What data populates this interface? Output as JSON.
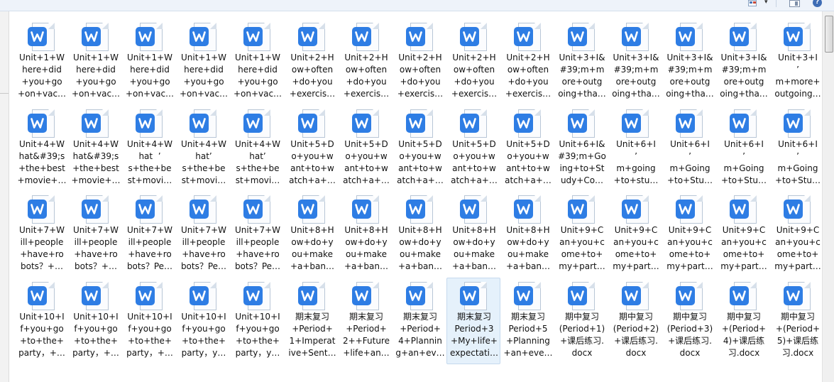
{
  "toolbar": {
    "icons": [
      "view-options-icon",
      "dropdown-arrow-icon",
      "preview-pane-icon",
      "help-icon"
    ],
    "arrow_glyph": "▾",
    "help_glyph": "?"
  },
  "colors": {
    "wps_blue": "#2e7de4",
    "selection_bg": "#e5f1fb",
    "selection_border": "#c5d9ee"
  },
  "files": [
    [
      "Unit+1+W\nhere+did\n+you+go\n+on+vac…",
      "Unit+1+W\nhere+did\n+you+go\n+on+vac…",
      "Unit+1+W\nhere+did\n+you+go\n+on+vac…",
      "Unit+1+W\nhere+did\n+you+go\n+on+vac…",
      "Unit+1+W\nhere+did\n+you+go\n+on+vac…",
      "Unit+2+H\now+often\n+do+you\n+exercis…",
      "Unit+2+H\now+often\n+do+you\n+exercis…",
      "Unit+2+H\now+often\n+do+you\n+exercis…",
      "Unit+2+H\now+often\n+do+you\n+exercis…",
      "Unit+2+H\now+often\n+do+you\n+exercis…",
      "Unit+3+I&\n#39;m+m\nore+outg\noing+tha…",
      "Unit+3+I&\n#39;m+m\nore+outg\noing+tha…",
      "Unit+3+I&\n#39;m+m\nore+outg\noing+tha…",
      "Unit+3+I&\n#39;m+m\nore+outg\noing+tha…",
      "Unit+3+I\n’\nm+more+\noutgoing…"
    ],
    [
      "Unit+4+W\nhat&#39;s\n+the+best\n+movie+…",
      "Unit+4+W\nhat&#39;s\n+the+best\n+movie+…",
      "Unit+4+W\nhat  ’\ns+the+be\nst+movi…",
      "Unit+4+W\nhat’\ns+the+be\nst+movi…",
      "Unit+4+W\nhat’\ns+the+be\nst+movi…",
      "Unit+5+D\no+you+w\nant+to+w\natch+a+…",
      "Unit+5+D\no+you+w\nant+to+w\natch+a+…",
      "Unit+5+D\no+you+w\nant+to+w\natch+a+…",
      "Unit+5+D\no+you+w\nant+to+w\natch+a+…",
      "Unit+5+D\no+you+w\nant+to+w\natch+a+…",
      "Unit+6+I&\n#39;m+Go\ning+to+St\nudy+Co…",
      "Unit+6+I\n’\nm+going\n+to+stu…",
      "Unit+6+I\n’\nm+Going\n+to+Stu…",
      "Unit+6+I\n’\nm+Going\n+to+Stu…",
      "Unit+6+I\n’\nm+Going\n+to+Stu…"
    ],
    [
      "Unit+7+W\nill+people\n+have+ro\nbots？+…",
      "Unit+7+W\nill+people\n+have+ro\nbots？+…",
      "Unit+7+W\nill+people\n+have+ro\nbots？Pe…",
      "Unit+7+W\nill+people\n+have+ro\nbots？Pe…",
      "Unit+7+W\nill+people\n+have+ro\nbots？Pe…",
      "Unit+8+H\now+do+y\nou+make\n+a+ban…",
      "Unit+8+H\now+do+y\nou+make\n+a+ban…",
      "Unit+8+H\now+do+y\nou+make\n+a+ban…",
      "Unit+8+H\now+do+y\nou+make\n+a+ban…",
      "Unit+8+H\now+do+y\nou+make\n+a+ban…",
      "Unit+9+C\nan+you+c\nome+to+\nmy+part…",
      "Unit+9+C\nan+you+c\nome+to+\nmy+part…",
      "Unit+9+C\nan+you+c\nome+to+\nmy+part…",
      "Unit+9+C\nan+you+c\nome+to+\nmy+part…",
      "Unit+9+C\nan+you+c\nome+to+\nmy+part…"
    ],
    [
      "Unit+10+I\nf+you+go\n+to+the+\nparty，+…",
      "Unit+10+I\nf+you+go\n+to+the+\nparty，+…",
      "Unit+10+I\nf+you+go\n+to+the+\nparty，+…",
      "Unit+10+I\nf+you+go\n+to+the+\nparty，y…",
      "Unit+10+I\nf+you+go\n+to+the+\nparty，y…",
      "期末复习\n+Period+\n1+Imperat\nive+Sent…",
      "期末复习\n+Period+\n2++Future\n+life+an…",
      "期末复习\n+Period+\n4+Plannin\ng+an+ev…",
      "期末复习\nPeriod+3\n+My+life+\nexpectati…",
      "期末复习\nPeriod+5\n+Planning\n+an+eve…",
      "期中复习\n(Period+1)\n+课后练习.\ndocx",
      "期中复习\n(Period+2)\n+课后练习.\ndocx",
      "期中复习\n(Period+3)\n+课后练习.\ndocx",
      "期中复习\n+(Period+\n4)+课后练\n习.docx",
      "期中复习\n+(Period+\n5)+课后练\n习.docx"
    ]
  ],
  "selected": {
    "row": 3,
    "col": 8
  }
}
